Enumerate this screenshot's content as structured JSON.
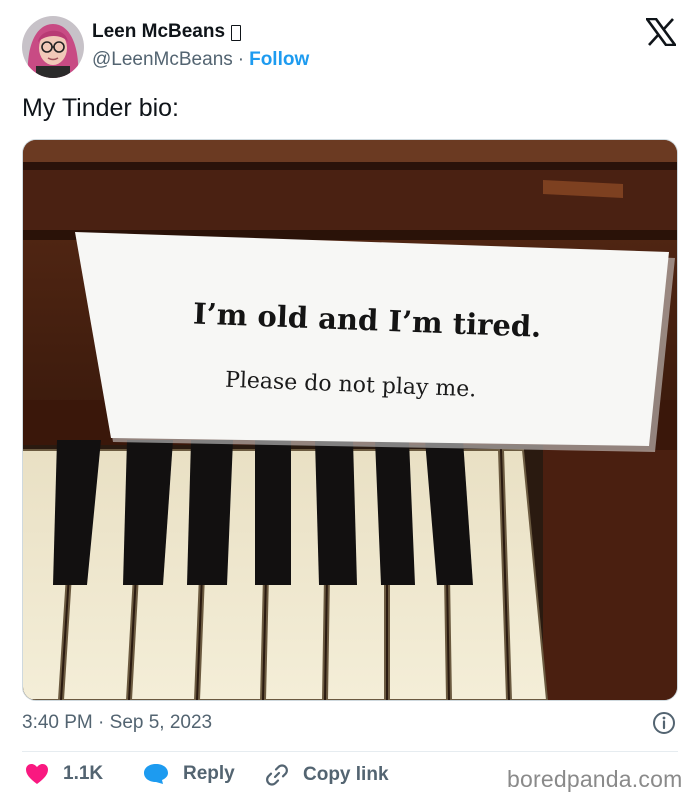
{
  "author": {
    "display_name": "Leen McBeans",
    "handle": "@LeenMcBeans",
    "separator": "·",
    "follow_label": "Follow"
  },
  "platform_icon": "x-logo-icon",
  "tweet": {
    "text": "My Tinder bio:"
  },
  "media": {
    "sign_line1": "I’m old and I’m tired.",
    "sign_line2": "Please do not play me."
  },
  "meta": {
    "timestamp": "3:40 PM · Sep 5, 2023",
    "info_icon": "info-icon"
  },
  "actions": {
    "like_count": "1.1K",
    "reply_label": "Reply",
    "copy_link_label": "Copy link"
  },
  "watermark": "boredpanda.com",
  "colors": {
    "accent": "#1d9bf0",
    "like": "#f91880",
    "text": "#0f1419",
    "secondary": "#536471"
  }
}
